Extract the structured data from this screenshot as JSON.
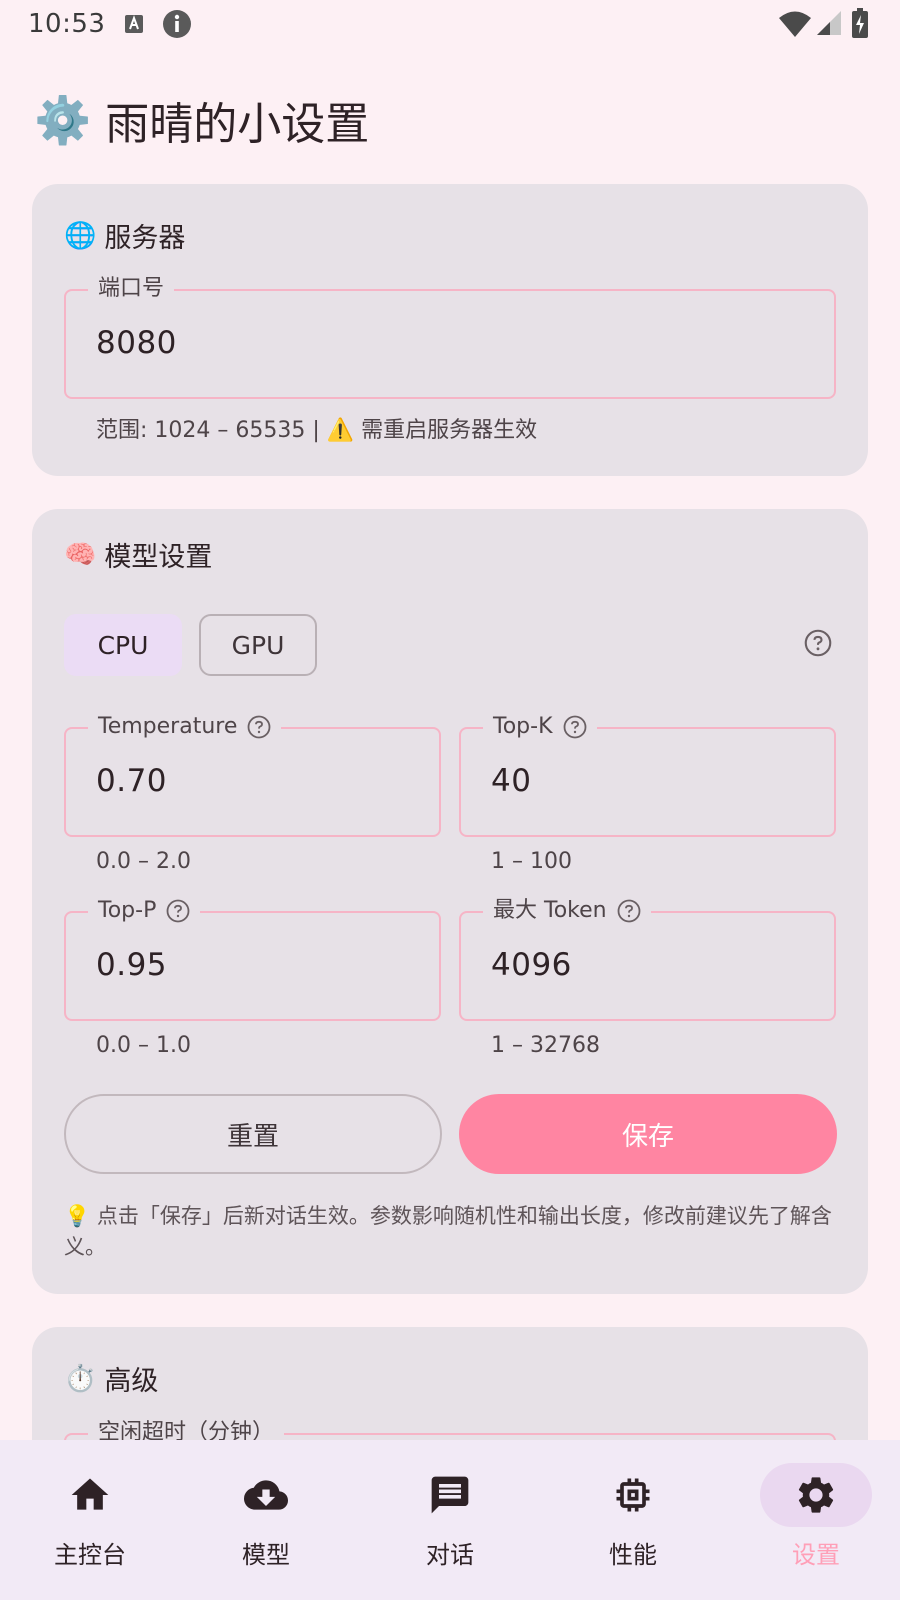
{
  "status_bar": {
    "time": "10:53",
    "icons": [
      "a-notification-icon",
      "info-icon",
      "wifi-icon",
      "signal-icon",
      "battery-icon"
    ]
  },
  "header": {
    "icon": "gear-icon",
    "icon_glyph": "⚙️",
    "title": "雨晴的小设置"
  },
  "server_card": {
    "emoji": "🌐",
    "title": "服务器",
    "port_field": {
      "label": "端口号",
      "value": "8080",
      "hint": "范围: 1024 – 65535 | ⚠️ 需重启服务器生效"
    }
  },
  "model_card": {
    "emoji": "🧠",
    "title": "模型设置",
    "modes": [
      {
        "label": "CPU",
        "selected": true
      },
      {
        "label": "GPU",
        "selected": false
      }
    ],
    "fields": {
      "temperature": {
        "label": "Temperature",
        "value": "0.70",
        "hint": "0.0 – 2.0"
      },
      "top_k": {
        "label": "Top-K",
        "value": "40",
        "hint": "1 – 100"
      },
      "top_p": {
        "label": "Top-P",
        "value": "0.95",
        "hint": "0.0 – 1.0"
      },
      "max_token": {
        "label": "最大 Token",
        "value": "4096",
        "hint": "1 – 32768"
      }
    },
    "reset_label": "重置",
    "save_label": "保存",
    "tip": "💡 点击「保存」后新对话生效。参数影响随机性和输出长度，修改前建议先了解含义。"
  },
  "advanced_card": {
    "emoji": "⏱️",
    "title": "高级",
    "idle_field": {
      "label": "空闲超时（分钟）"
    }
  },
  "bottom_nav": {
    "active": "设置",
    "items": [
      {
        "label": "主控台",
        "icon": "home-icon"
      },
      {
        "label": "模型",
        "icon": "cloud-download-icon"
      },
      {
        "label": "对话",
        "icon": "chat-icon"
      },
      {
        "label": "性能",
        "icon": "chip-icon"
      },
      {
        "label": "设置",
        "icon": "gear-icon"
      }
    ]
  },
  "colors": {
    "background": "#fdf0f4",
    "card": "#e7e1e7",
    "field_outline": "#f6b4c6",
    "primary": "#ff85a2",
    "chip_selected": "#ebdcf5",
    "nav_active_indicator": "#ead8f0",
    "nav_active_label": "#ff9fb7"
  }
}
